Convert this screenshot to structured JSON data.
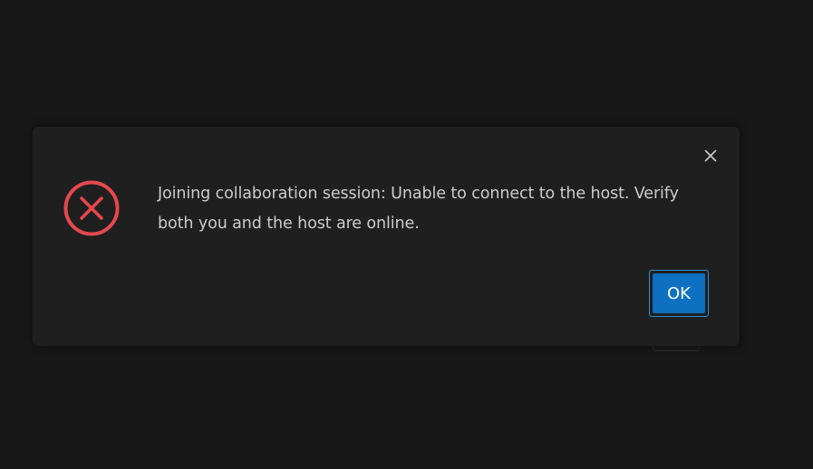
{
  "dialog": {
    "message": "Joining collaboration session: Unable to connect to the host. Verify both you and the host are online.",
    "icon": "error-circle-x-icon",
    "close_icon": "close-icon",
    "ok_label": "OK"
  },
  "colors": {
    "background": "#181818",
    "dialog_background": "#1f1f1f",
    "error_red": "#e5484d",
    "button_blue": "#0e70c0",
    "text": "#cccccc"
  }
}
